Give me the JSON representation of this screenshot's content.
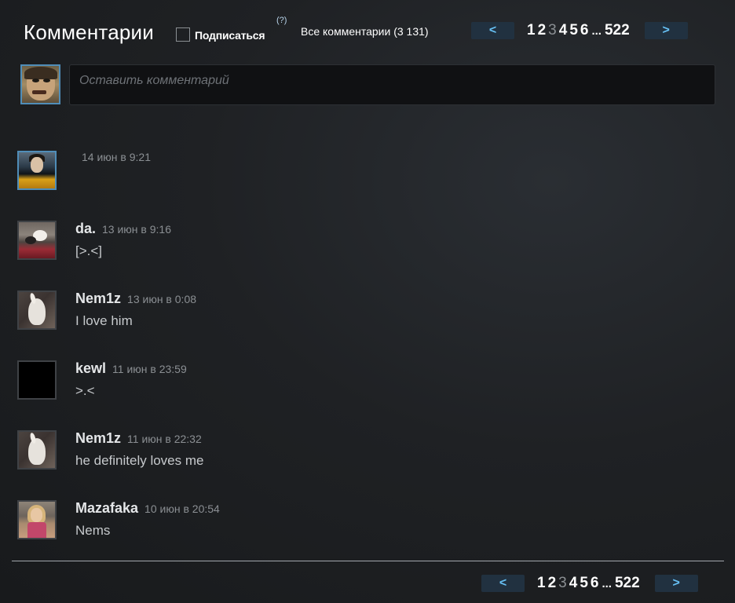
{
  "header": {
    "title": "Комментарии",
    "subscribe_label": "Подписаться",
    "help_label": "(?)",
    "all_comments_label": "Все комментарии (3 131)"
  },
  "pagination": {
    "prev_label": "<",
    "next_label": ">",
    "pages": [
      "1",
      "2",
      "3",
      "4",
      "5",
      "6"
    ],
    "current_page": "3",
    "ellipsis": "...",
    "last_page": "522"
  },
  "comment_input": {
    "placeholder": "Оставить комментарий"
  },
  "comments": [
    {
      "author": "",
      "time": "14 июн в 9:21",
      "text": "",
      "avatar_icon": "user-avatar-suit-icon"
    },
    {
      "author": "da.",
      "time": "13 июн в 9:16",
      "text": "[>.<]",
      "avatar_icon": "user-avatar-cat-icon"
    },
    {
      "author": "Nem1z",
      "time": "13 июн в 0:08",
      "text": "I love him",
      "avatar_icon": "user-avatar-rabbit-icon"
    },
    {
      "author": "kewl",
      "time": "11 июн в 23:59",
      "text": ">.<",
      "avatar_icon": "user-avatar-black-icon"
    },
    {
      "author": "Nem1z",
      "time": "11 июн в 22:32",
      "text": "he definitely loves me",
      "avatar_icon": "user-avatar-rabbit-icon"
    },
    {
      "author": "Mazafaka",
      "time": "10 июн в 20:54",
      "text": "Nems",
      "avatar_icon": "user-avatar-girl-icon"
    }
  ],
  "colors": {
    "accent": "#67c1f5",
    "button_bg": "#213140",
    "avatar_border_active": "#4f8db8"
  }
}
